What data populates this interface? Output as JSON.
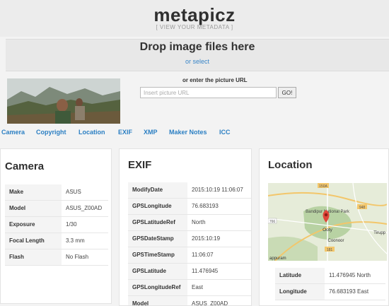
{
  "header": {
    "logo": "metapicz",
    "tagline": "[ VIEW YOUR METADATA ]"
  },
  "dropzone": {
    "title": "Drop image files here",
    "select_link": "or select"
  },
  "url_form": {
    "label": "or enter the picture URL",
    "placeholder": "Insert picture URL",
    "button": "GO!"
  },
  "tabs": [
    "Camera",
    "Copyright",
    "Location",
    "EXIF",
    "XMP",
    "Maker Notes",
    "ICC"
  ],
  "camera": {
    "title": "Camera",
    "rows": [
      {
        "key": "Make",
        "value": "ASUS"
      },
      {
        "key": "Model",
        "value": "ASUS_Z00AD"
      },
      {
        "key": "Exposure",
        "value": "1/30"
      },
      {
        "key": "Focal Length",
        "value": "3.3 mm"
      },
      {
        "key": "Flash",
        "value": "No Flash"
      }
    ]
  },
  "exif": {
    "title": "EXIF",
    "rows": [
      {
        "key": "ModifyDate",
        "value": "2015:10:19 11:06:07"
      },
      {
        "key": "GPSLongitude",
        "value": "76.683193"
      },
      {
        "key": "GPSLatitudeRef",
        "value": "North"
      },
      {
        "key": "GPSDateStamp",
        "value": "2015:10:19"
      },
      {
        "key": "GPSTimeStamp",
        "value": "11:06:07"
      },
      {
        "key": "GPSLatitude",
        "value": "11.476945"
      },
      {
        "key": "GPSLongitudeRef",
        "value": "East"
      },
      {
        "key": "Model",
        "value": "ASUS_Z00AD"
      }
    ]
  },
  "location": {
    "title": "Location",
    "map_labels": {
      "park": "Bandipur National Park",
      "town1": "Ooty",
      "town2": "Coonoor",
      "place": "appuram",
      "place2": "Tirupp",
      "road1": "150A",
      "road2": "948",
      "road3": "766",
      "road4": "181"
    },
    "rows": [
      {
        "key": "Latitude",
        "value": "11.476945 North"
      },
      {
        "key": "Longitude",
        "value": "76.683193 East"
      }
    ]
  },
  "colors": {
    "accent": "#2b7fc3",
    "map_pin": "#e0463a"
  }
}
